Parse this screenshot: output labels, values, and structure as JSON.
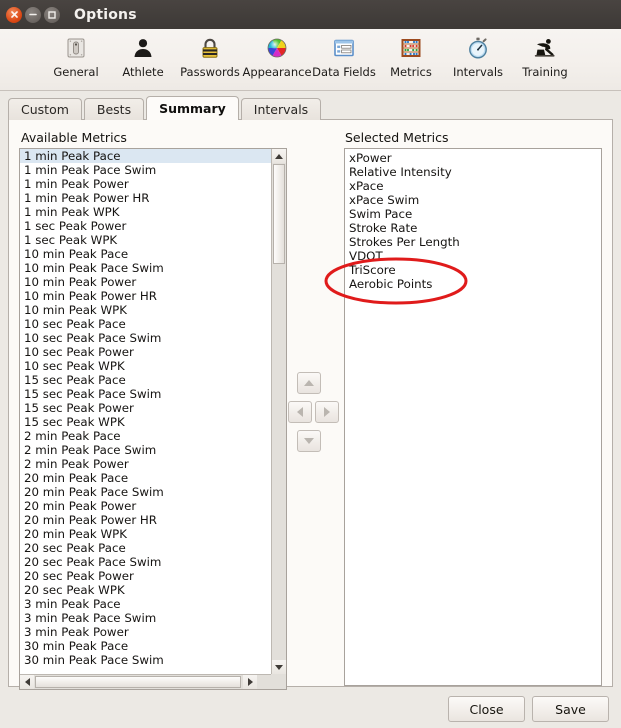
{
  "window": {
    "title": "Options",
    "buttons": [
      {
        "name": "close",
        "glyph": "×"
      },
      {
        "name": "minimize",
        "glyph": "−"
      },
      {
        "name": "maximize",
        "glyph": "□"
      }
    ]
  },
  "toolbar": {
    "items": [
      {
        "label": "General",
        "icon": "toggle-switch-icon"
      },
      {
        "label": "Athlete",
        "icon": "person-icon"
      },
      {
        "label": "Passwords",
        "icon": "padlock-icon"
      },
      {
        "label": "Appearance",
        "icon": "color-wheel-icon"
      },
      {
        "label": "Data Fields",
        "icon": "form-fields-icon"
      },
      {
        "label": "Metrics",
        "icon": "abacus-icon"
      },
      {
        "label": "Intervals",
        "icon": "stopwatch-icon"
      },
      {
        "label": "Training",
        "icon": "cyclist-icon"
      }
    ]
  },
  "tabs": [
    {
      "label": "Custom",
      "active": false
    },
    {
      "label": "Bests",
      "active": false
    },
    {
      "label": "Summary",
      "active": true
    },
    {
      "label": "Intervals",
      "active": false
    }
  ],
  "available": {
    "label": "Available Metrics",
    "selected_index": 0,
    "items": [
      "1 min Peak Pace",
      "1 min Peak Pace Swim",
      "1 min Peak Power",
      "1 min Peak Power HR",
      "1 min Peak WPK",
      "1 sec Peak Power",
      "1 sec Peak WPK",
      "10 min Peak Pace",
      "10 min Peak Pace Swim",
      "10 min Peak Power",
      "10 min Peak Power HR",
      "10 min Peak WPK",
      "10 sec Peak Pace",
      "10 sec Peak Pace Swim",
      "10 sec Peak Power",
      "10 sec Peak WPK",
      "15 sec Peak Pace",
      "15 sec Peak Pace Swim",
      "15 sec Peak Power",
      "15 sec Peak WPK",
      "2 min Peak Pace",
      "2 min Peak Pace Swim",
      "2 min Peak Power",
      "20 min Peak Pace",
      "20 min Peak Pace Swim",
      "20 min Peak Power",
      "20 min Peak Power HR",
      "20 min Peak WPK",
      "20 sec Peak Pace",
      "20 sec Peak Pace Swim",
      "20 sec Peak Power",
      "20 sec Peak WPK",
      "3 min Peak Pace",
      "3 min Peak Pace Swim",
      "3 min Peak Power",
      "30 min Peak Pace",
      "30 min Peak Pace Swim"
    ]
  },
  "selected": {
    "label": "Selected Metrics",
    "items": [
      "xPower",
      "Relative Intensity",
      "xPace",
      "xPace Swim",
      "Swim Pace",
      "Stroke Rate",
      "Strokes Per Length",
      "VDOT",
      "TriScore",
      "Aerobic Points"
    ]
  },
  "move_buttons": [
    {
      "name": "move-up-button",
      "icon": "arrow-up-icon"
    },
    {
      "name": "move-left-button",
      "icon": "arrow-left-icon"
    },
    {
      "name": "move-right-button",
      "icon": "arrow-right-icon"
    },
    {
      "name": "move-down-button",
      "icon": "arrow-down-icon"
    }
  ],
  "dialog_buttons": {
    "close": "Close",
    "save": "Save"
  },
  "annotation": {
    "shape": "ellipse",
    "color": "#e01b1b",
    "encircles": [
      "TriScore",
      "Aerobic Points"
    ]
  },
  "colors": {
    "titlebar": "#3d3936",
    "window_bg": "#ece9e4",
    "panel_bg": "#fcfaf7",
    "list_bg": "#ffffff",
    "selection": "#dbe7f2",
    "accent_close": "#dd4814",
    "annotation": "#e01b1b"
  }
}
